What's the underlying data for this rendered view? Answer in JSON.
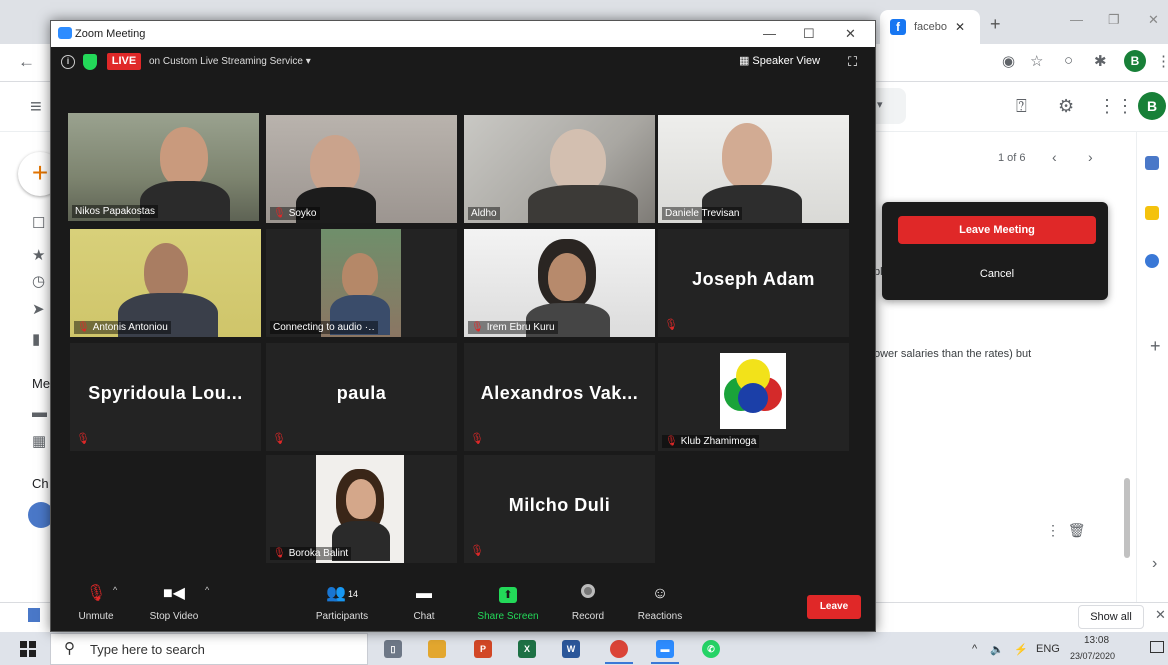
{
  "browser": {
    "tab_title": "facebo",
    "new_tab": "+",
    "profile_initial": "B"
  },
  "gmail": {
    "avatar_initial": "B",
    "pager": "1 of 6",
    "email_snippet": "ower salaries than the rates) but",
    "email_fragment": "pl",
    "sidebar_labels": [
      "Me",
      "Ch"
    ]
  },
  "downloads": {
    "show_all": "Show all"
  },
  "taskbar": {
    "search_placeholder": "Type here to search",
    "time": "13:08",
    "date": "23/07/2020",
    "language": "ENG"
  },
  "zoom": {
    "window_title": "Zoom Meeting",
    "live_label": "LIVE",
    "stream_label": "on Custom Live Streaming Service",
    "speaker_view": "Speaker View",
    "tiles": [
      {
        "name": "Nikos Papakostas",
        "muted": false
      },
      {
        "name": "Soyko",
        "muted": true
      },
      {
        "name": "Aldho",
        "muted": false
      },
      {
        "name": "Daniele Trevisan",
        "muted": false
      },
      {
        "name": "Antonis Antoniou",
        "muted": true
      },
      {
        "name": "Connecting to audio",
        "muted": false
      },
      {
        "name": "Irem Ebru Kuru",
        "muted": true
      },
      {
        "name": "Joseph Adam",
        "muted": true
      },
      {
        "name": "Spyridoula Lou...",
        "muted": true
      },
      {
        "name": "paula",
        "muted": true
      },
      {
        "name": "Alexandros Vak...",
        "muted": true
      },
      {
        "name": "Klub Zhamimoga",
        "muted": true
      },
      {
        "name": "Boroka Balint",
        "muted": true
      },
      {
        "name": "Milcho Duli",
        "muted": true
      }
    ],
    "toolbar": {
      "unmute": "Unmute",
      "stop_video": "Stop Video",
      "participants": "Participants",
      "participant_count": "14",
      "chat": "Chat",
      "share_screen": "Share Screen",
      "record": "Record",
      "reactions": "Reactions",
      "leave": "Leave"
    },
    "leave_popup": {
      "leave_meeting": "Leave Meeting",
      "cancel": "Cancel"
    }
  },
  "colors": {
    "zoom_bg": "#1a1a1a",
    "live_red": "#e02828",
    "share_green": "#23d959",
    "active_speaker_outline": "#b9e56b",
    "gmail_avatar": "#188038"
  }
}
